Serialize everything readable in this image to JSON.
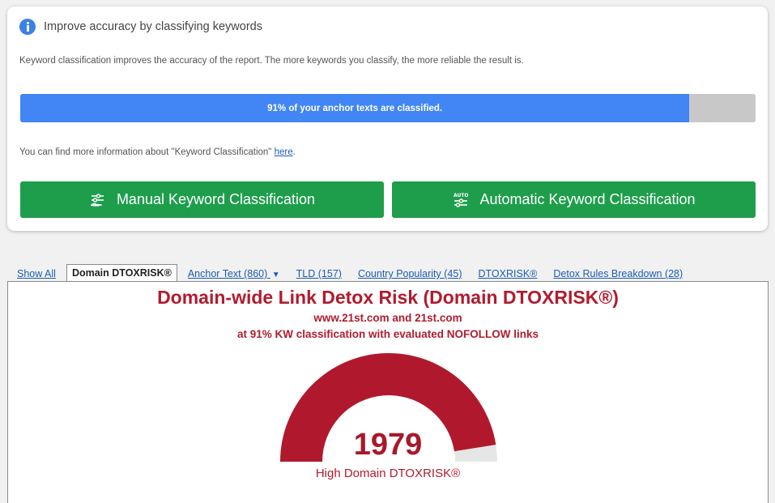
{
  "classification_card": {
    "title": "Improve accuracy by classifying keywords",
    "description": "Keyword classification improves the accuracy of the report. The more keywords you classify, the more reliable the result is.",
    "progress_percent": 91,
    "progress_text": "91% of your anchor texts are classified.",
    "more_info_prefix": "You can find more information about \"Keyword Classification\"",
    "more_info_link": "here",
    "more_info_suffix": ".",
    "manual_button": "Manual Keyword Classification",
    "auto_button": "Automatic Keyword Classification",
    "auto_icon_text": "AUTO",
    "colors": {
      "progress_fill": "#4285f4",
      "button": "#1e9e4b",
      "info_icon": "#3b82e6"
    }
  },
  "tabs": [
    {
      "label": "Show All",
      "active": false
    },
    {
      "label": "Domain DTOXRISK®",
      "active": true
    },
    {
      "label": "Anchor Text (860)",
      "active": false,
      "caret": "▼"
    },
    {
      "label": "TLD (157)",
      "active": false
    },
    {
      "label": "Country Popularity (45)",
      "active": false
    },
    {
      "label": "DTOXRISK®",
      "active": false
    },
    {
      "label": "Detox Rules Breakdown (28)",
      "active": false
    }
  ],
  "risk_panel": {
    "title": "Domain-wide Link Detox Risk (Domain DTOXRISK®)",
    "subtitle_domains": "www.21st.com and 21st.com",
    "subtitle_classification": "at 91% KW classification with evaluated NOFOLLOW links",
    "gauge_value": "1979",
    "gauge_fraction": 0.95,
    "gauge_label": "High Domain DTOXRISK®",
    "colors": {
      "gauge_fill": "#b0192d",
      "gauge_track": "#e6e6e6",
      "text": "#b01c2e"
    }
  }
}
